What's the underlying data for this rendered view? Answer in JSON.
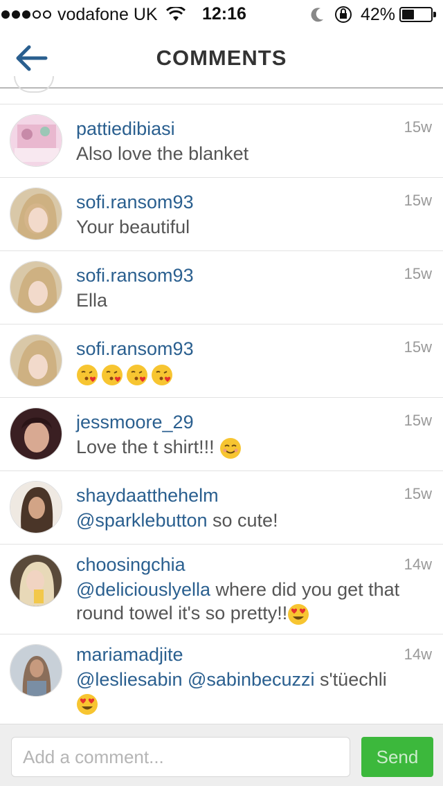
{
  "status_bar": {
    "carrier": "vodafone UK",
    "time": "12:16",
    "battery_percent": "42%",
    "battery_level": 0.42,
    "signal_bars": 3,
    "signal_total": 5
  },
  "nav": {
    "title": "COMMENTS",
    "back_icon": "back-arrow-icon"
  },
  "comments": [
    {
      "username": "pattiedibiasi",
      "time": "15w",
      "text": "Also love  the blanket"
    },
    {
      "username": "sofi.ransom93",
      "time": "15w",
      "text": "Your beautiful"
    },
    {
      "username": "sofi.ransom93",
      "time": "15w",
      "text": "Ella"
    },
    {
      "username": "sofi.ransom93",
      "time": "15w",
      "emoji": [
        "kissing-heart-emoji",
        "kissing-heart-emoji",
        "kissing-heart-emoji",
        "kissing-heart-emoji"
      ]
    },
    {
      "username": "jessmoore_29",
      "time": "15w",
      "text": "Love the t shirt!!!",
      "emoji": [
        "smiling-face-emoji"
      ]
    },
    {
      "username": "shaydaatthehelm",
      "time": "15w",
      "mention": "@sparklebutton",
      "text": " so cute!"
    },
    {
      "username": "choosingchia",
      "time": "14w",
      "mention": "@deliciouslyella",
      "text": " where did you get that round towel it's so pretty!!",
      "emoji": [
        "heart-eyes-emoji"
      ]
    },
    {
      "username": "mariamadjite",
      "time": "14w",
      "mention": "@lesliesabin",
      "mention2": "@sabinbecuzzi",
      "text": " s'tüechli",
      "emoji": [
        "heart-eyes-emoji"
      ]
    }
  ],
  "input": {
    "placeholder": "Add a comment...",
    "value": ""
  },
  "send_label": "Send",
  "colors": {
    "username": "#2a5f8f",
    "send_button": "#3cb83c",
    "back_arrow": "#2a5f8f"
  }
}
